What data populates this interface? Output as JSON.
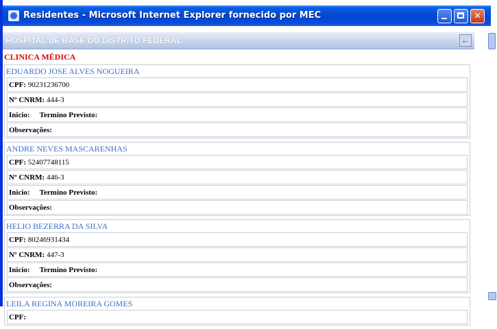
{
  "window": {
    "title": "Residentes - Microsoft Internet Explorer fornecido por MEC",
    "min_glyph": "",
    "max_glyph": "",
    "close_glyph": "✕"
  },
  "header": {
    "title": "HOSPITAL DE BASE DO DISTRITO FEDERAL",
    "back_glyph": "←"
  },
  "clinic": "CLINICA MÉDICA",
  "labels": {
    "cpf": "CPF:",
    "cnrm": "Nº CNRM:",
    "inicio": "Inicio:",
    "termino": "Termino Previsto:",
    "obs": "Observações:"
  },
  "residents": [
    {
      "name": "EDUARDO JOSE ALVES NOGUEIRA",
      "cpf": "90231236700",
      "cnrm": "444-3"
    },
    {
      "name": "ANDRE NEVES MASCARENHAS",
      "cpf": "52407748115",
      "cnrm": "446-3"
    },
    {
      "name": "HELIO BEZERRA DA SILVA",
      "cpf": "80246931434",
      "cnrm": "447-3"
    },
    {
      "name": "LEILA REGINA MOREIRA GOMES",
      "cpf": "",
      "cnrm": ""
    }
  ]
}
